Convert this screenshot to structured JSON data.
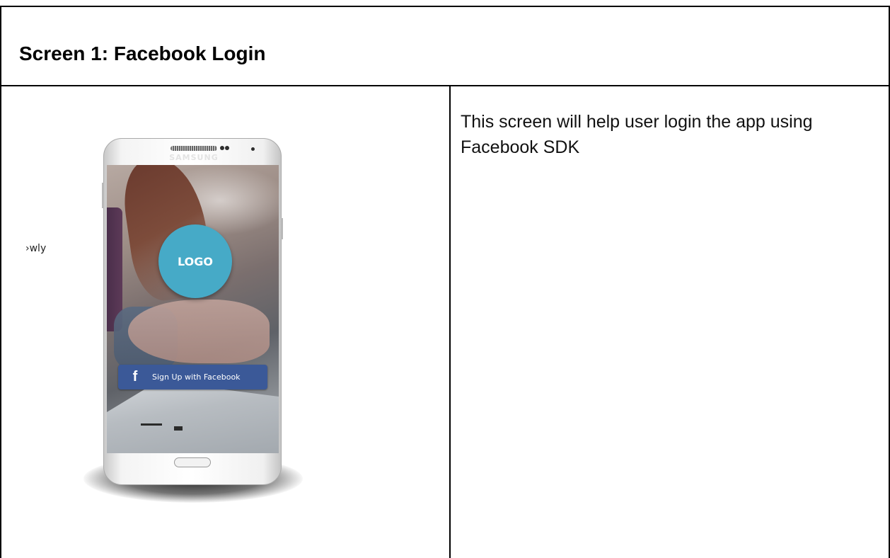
{
  "document": {
    "title": "Screen 1: Facebook Login",
    "side_text": "›wly",
    "description": "This screen will help user login the app using Facebook SDK"
  },
  "phone": {
    "brand": "SAMSUNG",
    "logo_text": "LOGO",
    "facebook_button": {
      "icon": "facebook-f-icon",
      "label": "Sign Up with Facebook"
    }
  },
  "colors": {
    "logo_circle": "#46aac7",
    "facebook_button": "#3b5998",
    "border": "#000000"
  }
}
